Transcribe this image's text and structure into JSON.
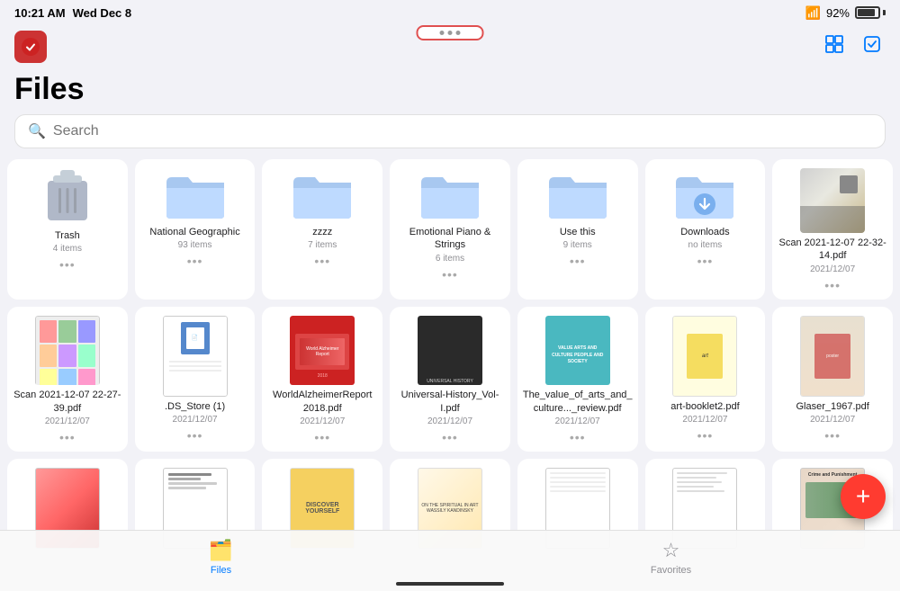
{
  "statusBar": {
    "time": "10:21 AM",
    "date": "Wed Dec 8",
    "wifi": "92%",
    "battery": "92%"
  },
  "header": {
    "title": "Files",
    "searchPlaceholder": "Search"
  },
  "topDotsBtn": {
    "label": "···"
  },
  "grid": {
    "row1": [
      {
        "id": "trash",
        "type": "trash",
        "name": "Trash",
        "sub": "4 items"
      },
      {
        "id": "national-geographic",
        "type": "folder",
        "name": "National Geographic",
        "sub": "93 items"
      },
      {
        "id": "zzzz",
        "type": "folder",
        "name": "zzzz",
        "sub": "7 items"
      },
      {
        "id": "emotional-piano",
        "type": "folder",
        "name": "Emotional Piano & Strings",
        "sub": "6 items"
      },
      {
        "id": "use-this",
        "type": "folder",
        "name": "Use this",
        "sub": "9 items"
      },
      {
        "id": "downloads",
        "type": "folder-download",
        "name": "Downloads",
        "sub": "no items"
      },
      {
        "id": "scan-2021-1",
        "type": "photo",
        "name": "Scan 2021-12-07 22-32-14.pdf",
        "sub": "2021/12/07"
      }
    ],
    "row2": [
      {
        "id": "scan-2021-2",
        "type": "pdf-screenshot",
        "name": "Scan 2021-12-07 22-27-39.pdf",
        "sub": "2021/12/07"
      },
      {
        "id": "ds-store",
        "type": "pdf-doc",
        "name": ".DS_Store (1)",
        "sub": "2021/12/07"
      },
      {
        "id": "worldalzheimer",
        "type": "pdf-red",
        "name": "WorldAlzheimerReport 2018.pdf",
        "sub": "2021/12/07"
      },
      {
        "id": "universal-history",
        "type": "pdf-dark",
        "name": "Universal-History_Vol-I.pdf",
        "sub": "2021/12/07"
      },
      {
        "id": "arts-culture",
        "type": "pdf-teal",
        "name": "The_value_of_arts_and_culture..._review.pdf",
        "sub": "2021/12/07"
      },
      {
        "id": "art-booklet",
        "type": "pdf-white",
        "name": "art-booklet2.pdf",
        "sub": "2021/12/07"
      },
      {
        "id": "glaser",
        "type": "pdf-poster",
        "name": "Glaser_1967.pdf",
        "sub": "2021/12/07"
      }
    ],
    "row3": [
      {
        "id": "biomedical",
        "type": "pdf-biomedical",
        "name": "",
        "sub": ""
      },
      {
        "id": "short-intro",
        "type": "pdf-short-intro",
        "name": "",
        "sub": ""
      },
      {
        "id": "discover",
        "type": "pdf-discover",
        "name": "",
        "sub": ""
      },
      {
        "id": "spiritual-art",
        "type": "pdf-spiritual",
        "name": "",
        "sub": ""
      },
      {
        "id": "blank-pages",
        "type": "pdf-blank",
        "name": "",
        "sub": ""
      },
      {
        "id": "text-doc",
        "type": "pdf-text",
        "name": "",
        "sub": ""
      },
      {
        "id": "crime-punishment",
        "type": "pdf-crime",
        "name": "",
        "sub": ""
      }
    ]
  },
  "tabBar": {
    "items": [
      {
        "id": "files",
        "label": "Files",
        "active": true
      },
      {
        "id": "favorites",
        "label": "Favorites",
        "active": false
      }
    ]
  },
  "fab": {
    "label": "+"
  }
}
